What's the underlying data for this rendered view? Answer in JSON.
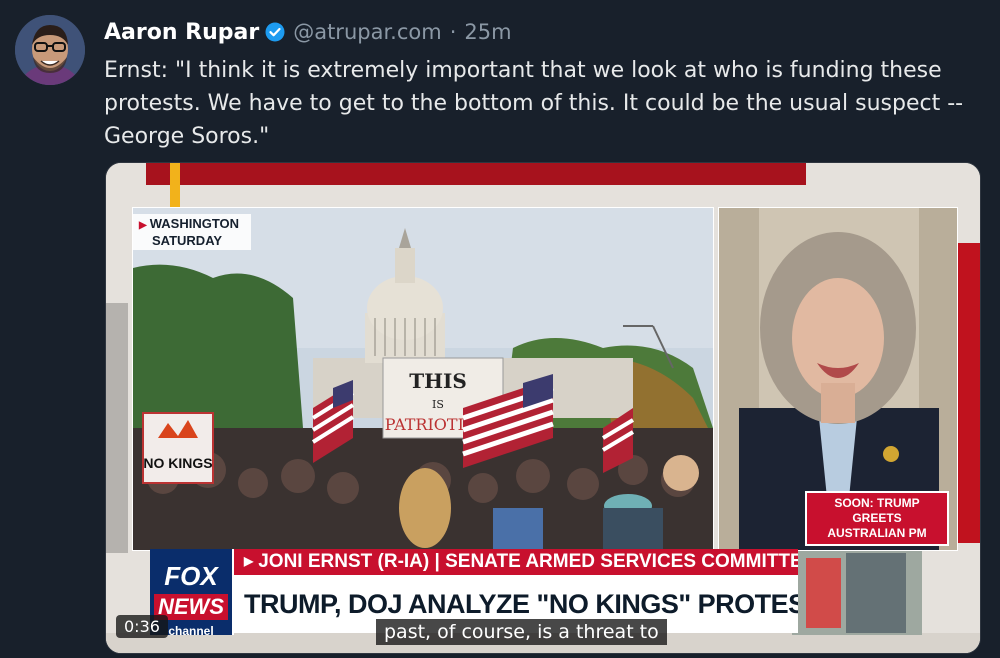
{
  "author": {
    "name": "Aaron Rupar",
    "handle": "@atrupar.com",
    "separator": "·",
    "time": "25m"
  },
  "tweet": {
    "text": "Ernst: \"I think it is extremely important that we look at who is funding these protests. We have to get to the bottom of this. It could be the usual suspect -- George Soros.\""
  },
  "video": {
    "timestamp": "0:36",
    "caption": "past, of course, is a threat to",
    "location_tag": [
      "WASHINGTON",
      "SATURDAY"
    ],
    "soon_banner": [
      "SOON: TRUMP GREETS",
      "AUSTRALIAN PM"
    ],
    "name_bar": "JONI ERNST (R-IA) | SENATE ARMED SERVICES COMMITTEE",
    "headline": "TRUMP, DOJ ANALYZE \"NO KINGS\" PROTESTS, FUNDING",
    "logo": {
      "line1": "FOX",
      "line2": "NEWS",
      "line3": "channel"
    },
    "signs": {
      "this": "THIS",
      "is": "IS",
      "patriotism": "PATRIOTISM",
      "no_kings": "NO KINGS"
    }
  },
  "colors": {
    "background": "#18202b",
    "fox_red": "#c8102e",
    "fox_blue": "#0a2d6b",
    "verified_blue": "#1d9bf0"
  }
}
